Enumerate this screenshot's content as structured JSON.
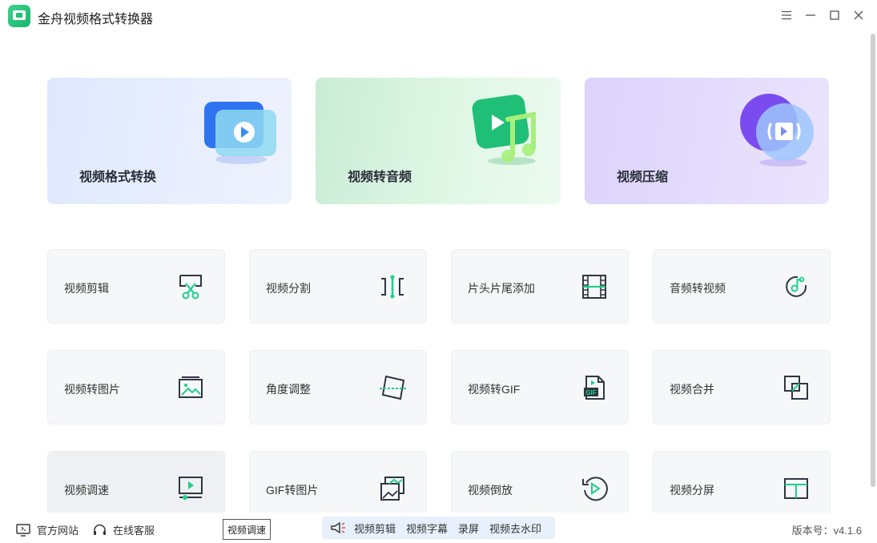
{
  "app": {
    "title": "金舟视频格式转换器"
  },
  "window_controls": [
    "menu-icon",
    "minimize-icon",
    "maximize-icon",
    "close-icon"
  ],
  "features": [
    {
      "label": "视频格式转换",
      "icon": "video-convert-icon",
      "color": "#3d7cf5"
    },
    {
      "label": "视频转音频",
      "icon": "music-note-icon",
      "color": "#22c07a"
    },
    {
      "label": "视频压缩",
      "icon": "compress-icon",
      "color": "#7c5cf0"
    }
  ],
  "tools": [
    {
      "label": "视频剪辑",
      "icon": "scissors-icon"
    },
    {
      "label": "视频分割",
      "icon": "split-icon"
    },
    {
      "label": "片头片尾添加",
      "icon": "film-icon"
    },
    {
      "label": "音频转视频",
      "icon": "audio-disc-icon"
    },
    {
      "label": "视频转图片",
      "icon": "image-icon"
    },
    {
      "label": "角度调整",
      "icon": "rotate-frame-icon"
    },
    {
      "label": "视频转GIF",
      "icon": "gif-file-icon"
    },
    {
      "label": "视频合并",
      "icon": "merge-icon"
    },
    {
      "label": "视频调速",
      "icon": "speed-icon"
    },
    {
      "label": "GIF转图片",
      "icon": "gif-image-icon"
    },
    {
      "label": "视频倒放",
      "icon": "reverse-play-icon"
    },
    {
      "label": "视频分屏",
      "icon": "split-screen-icon"
    }
  ],
  "bottom": {
    "website": "官方网站",
    "support": "在线客服",
    "tooltip": "视频调速",
    "quick_links": [
      "视频剪辑",
      "视频字幕",
      "录屏",
      "视频去水印"
    ],
    "version": "版本号：v4.1.6"
  },
  "colors": {
    "accent": "#1fbf77",
    "icon_dark": "#2f3542",
    "icon_green": "#1fcf8a"
  }
}
